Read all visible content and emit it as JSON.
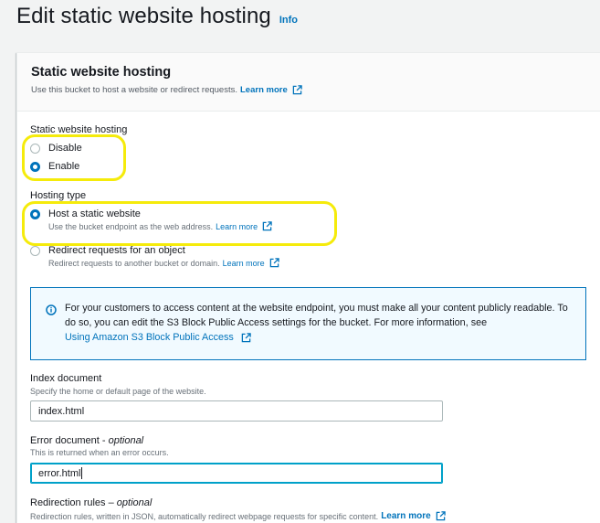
{
  "page": {
    "title": "Edit static website hosting",
    "info_label": "Info"
  },
  "panel": {
    "title": "Static website hosting",
    "description": "Use this bucket to host a website or redirect requests.",
    "learn_more": "Learn more"
  },
  "hosting_toggle": {
    "label": "Static website hosting",
    "options": [
      {
        "label": "Disable",
        "selected": false
      },
      {
        "label": "Enable",
        "selected": true
      }
    ]
  },
  "hosting_type": {
    "label": "Hosting type",
    "options": [
      {
        "label": "Host a static website",
        "description": "Use the bucket endpoint as the web address.",
        "learn_more": "Learn more",
        "selected": true
      },
      {
        "label": "Redirect requests for an object",
        "description": "Redirect requests to another bucket or domain.",
        "learn_more": "Learn more",
        "selected": false
      }
    ]
  },
  "alert": {
    "text": "For your customers to access content at the website endpoint, you must make all your content publicly readable. To do so, you can edit the S3 Block Public Access settings for the bucket. For more information, see",
    "link": "Using Amazon S3 Block Public Access"
  },
  "index_document": {
    "label": "Index document",
    "description": "Specify the home or default page of the website.",
    "value": "index.html"
  },
  "error_document": {
    "label": "Error document - ",
    "label_optional": "optional",
    "description": "This is returned when an error occurs.",
    "value": "error.html"
  },
  "redirection_rules": {
    "label": "Redirection rules – ",
    "label_optional": "optional",
    "description": "Redirection rules, written in JSON, automatically redirect webpage requests for specific content.",
    "learn_more": "Learn more"
  },
  "colors": {
    "accent": "#0073bb",
    "highlight": "#f5eb0b",
    "info_bg": "#f1faff",
    "focus": "#00a1c9"
  },
  "icons": [
    "external-link-icon",
    "info-circle-icon"
  ]
}
